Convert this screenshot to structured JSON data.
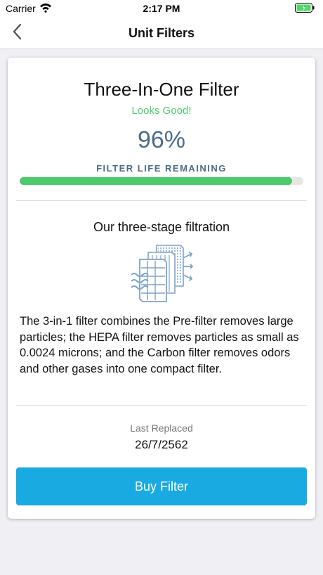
{
  "status_bar": {
    "carrier": "Carrier",
    "time": "2:17 PM",
    "battery_color": "#4cd964"
  },
  "nav": {
    "title": "Unit Filters",
    "back_icon": "chevron-left-icon"
  },
  "filter": {
    "name": "Three-In-One Filter",
    "status": "Looks Good!",
    "status_color": "#4cca6b",
    "life_percent_text": "96%",
    "life_percent": 96,
    "life_label": "FILTER LIFE REMAINING",
    "progress_color": "#4cca6b"
  },
  "filtration": {
    "heading": "Our three-stage filtration",
    "icon": "filter-stages-icon",
    "description": "The 3-in-1 filter combines the Pre-filter removes large particles; the HEPA filter removes particles as small as 0.0024 microns; and the Carbon filter removes odors and other gases into one compact filter."
  },
  "replacement": {
    "label": "Last Replaced",
    "date": "26/7/2562"
  },
  "actions": {
    "buy_label": "Buy Filter",
    "buy_color": "#19aae2"
  }
}
